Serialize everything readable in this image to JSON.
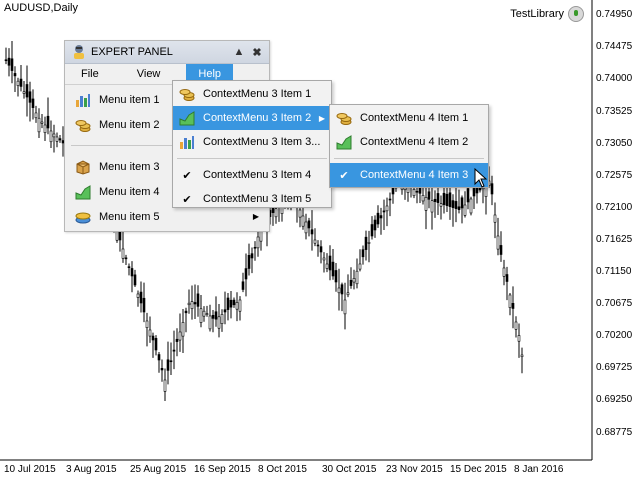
{
  "chart": {
    "symbol_label": "AUDUSD,Daily",
    "indicator_label": "TestLibrary",
    "price_labels": [
      "0.74950",
      "0.74475",
      "0.74000",
      "0.73525",
      "0.73050",
      "0.72575",
      "0.72100",
      "0.71625",
      "0.71150",
      "0.70675",
      "0.70200",
      "0.69725",
      "0.69250",
      "0.68775"
    ],
    "date_labels": [
      "10 Jul 2015",
      "3 Aug 2015",
      "25 Aug 2015",
      "16 Sep 2015",
      "8 Oct 2015",
      "30 Oct 2015",
      "23 Nov 2015",
      "15 Dec 2015",
      "8 Jan 2016"
    ],
    "colors": {
      "candle": "#000000",
      "background": "#ffffff",
      "axis": "#000000"
    }
  },
  "panel": {
    "title": "EXPERT PANEL",
    "menubar": [
      "File",
      "View",
      "Help"
    ],
    "active_menu": "Help",
    "items": [
      {
        "label": "Menu item 1",
        "icon": "bar-chart-icon"
      },
      {
        "label": "Menu item 2",
        "icon": "coins-icon"
      },
      {
        "label": "Menu item 3",
        "icon": "box-icon"
      },
      {
        "label": "Menu item 4",
        "icon": "area-chart-icon"
      },
      {
        "label": "Menu item 5",
        "icon": "disk-icon",
        "has_submenu": true
      }
    ]
  },
  "context_menu_3": {
    "items": [
      {
        "label": "ContextMenu 3 Item 1",
        "icon": "coins-icon"
      },
      {
        "label": "ContextMenu 3 Item 2",
        "icon": "area-chart-icon",
        "highlighted": true,
        "has_submenu": true
      },
      {
        "label": "ContextMenu 3 Item 3...",
        "icon": "bar-chart-icon"
      },
      {
        "label": "ContextMenu 3 Item 4",
        "checked": true
      },
      {
        "label": "ContextMenu 3 Item 5",
        "checked": true
      }
    ]
  },
  "context_menu_4": {
    "items": [
      {
        "label": "ContextMenu 4 Item 1",
        "icon": "coins-icon"
      },
      {
        "label": "ContextMenu 4 Item 2",
        "icon": "area-chart-icon"
      },
      {
        "label": "ContextMenu 4 Item 3",
        "checked": true,
        "highlighted": true
      }
    ]
  },
  "theme": {
    "highlight": "#3996e0",
    "panel_bg": "#f0f0f0"
  }
}
